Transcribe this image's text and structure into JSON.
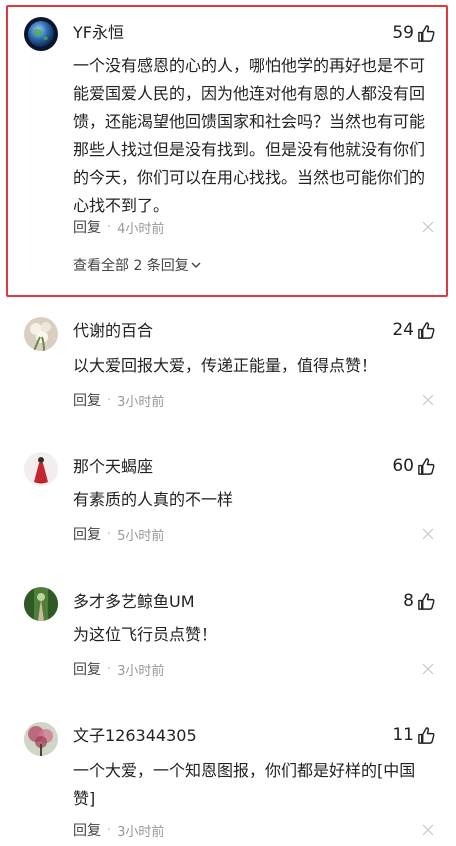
{
  "comments": [
    {
      "username": "YF永恒",
      "likes": "59",
      "content": "一个没有感恩的心的人，哪怕他学的再好也是不可能爱国爱人民的，因为他连对他有恩的人都没有回馈，还能渴望他回馈国家和社会吗？当然也有可能那些人找过但是没有找到。但是没有他就没有你们的今天，你们可以在用心找找。当然也可能你们的心找不到了。",
      "reply_label": "回复",
      "time": "4小时前",
      "view_replies": "查看全部 2 条回复",
      "avatar_icon": "globe-avatar",
      "highlighted": true
    },
    {
      "username": "代谢的百合",
      "likes": "24",
      "content": "以大爱回报大爱，传递正能量，值得点赞！",
      "reply_label": "回复",
      "time": "3小时前",
      "avatar_icon": "lily-avatar"
    },
    {
      "username": "那个天蝎座",
      "likes": "60",
      "content": "有素质的人真的不一样",
      "reply_label": "回复",
      "time": "5小时前",
      "avatar_icon": "red-dress-avatar"
    },
    {
      "username": "多才多艺鲸鱼UM",
      "likes": "8",
      "content": "为这位飞行员点赞！",
      "reply_label": "回复",
      "time": "3小时前",
      "avatar_icon": "forest-path-avatar"
    },
    {
      "username": "文子126344305",
      "likes": "11",
      "content": "一个大爱，一个知恩图报，你们都是好样的[中国赞]",
      "reply_label": "回复",
      "time": "3小时前",
      "avatar_icon": "flower-tree-avatar"
    }
  ],
  "colors": {
    "highlight_border": "#e0383e",
    "meta_text": "#999999",
    "primary_text": "#222222"
  }
}
